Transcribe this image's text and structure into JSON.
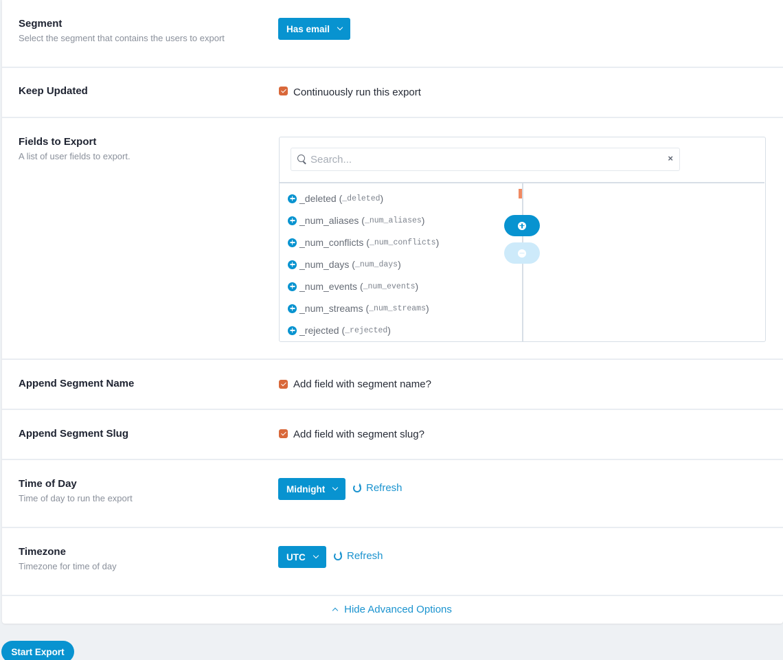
{
  "segment": {
    "label": "Segment",
    "description": "Select the segment that contains the users to export",
    "value": "Has email"
  },
  "keep_updated": {
    "label": "Keep Updated",
    "checkbox_label": "Continuously run this export",
    "checked": true
  },
  "fields": {
    "label": "Fields to Export",
    "description": "A list of user fields to export.",
    "search_placeholder": "Search...",
    "search_value": "",
    "clear_label": "×",
    "available": [
      {
        "name": "_deleted",
        "key": "_deleted"
      },
      {
        "name": "_num_aliases",
        "key": "_num_aliases"
      },
      {
        "name": "_num_conflicts",
        "key": "_num_conflicts"
      },
      {
        "name": "_num_days",
        "key": "_num_days"
      },
      {
        "name": "_num_events",
        "key": "_num_events"
      },
      {
        "name": "_num_streams",
        "key": "_num_streams"
      },
      {
        "name": "_rejected",
        "key": "_rejected"
      }
    ],
    "selected": []
  },
  "append_name": {
    "label": "Append Segment Name",
    "checkbox_label": "Add field with segment name?",
    "checked": true
  },
  "append_slug": {
    "label": "Append Segment Slug",
    "checkbox_label": "Add field with segment slug?",
    "checked": true
  },
  "time_of_day": {
    "label": "Time of Day",
    "description": "Time of day to run the export",
    "value": "Midnight",
    "refresh_label": "Refresh"
  },
  "timezone": {
    "label": "Timezone",
    "description": "Timezone for time of day",
    "value": "UTC",
    "refresh_label": "Refresh"
  },
  "hide_advanced_label": "Hide Advanced Options",
  "start_export_label": "Start Export",
  "colors": {
    "primary": "#0893d0",
    "checkbox": "#d9683a",
    "link": "#1a93cf"
  }
}
